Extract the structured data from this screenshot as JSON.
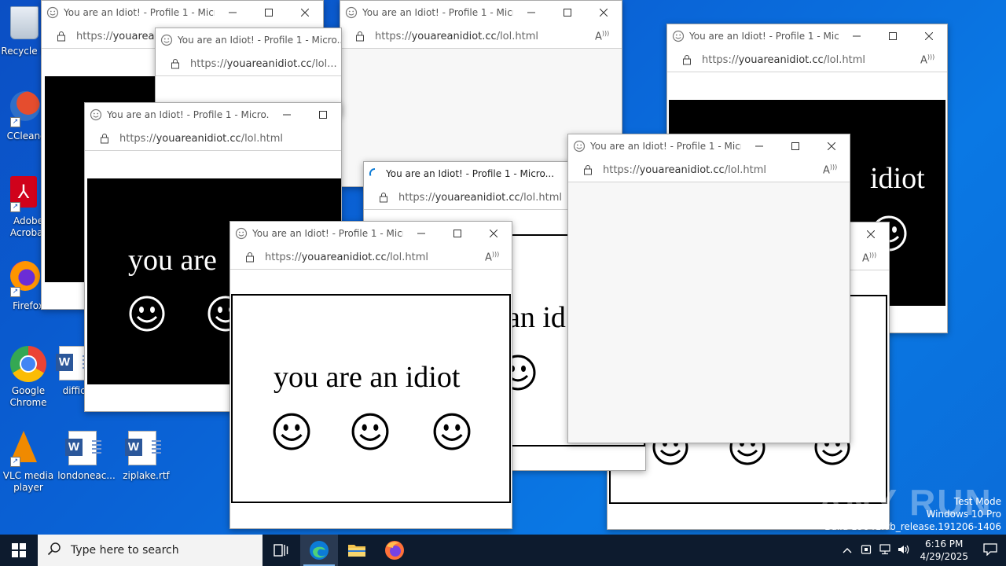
{
  "desktop": {
    "icons": [
      {
        "label": "Recycle Bin",
        "icon": "recycle-bin-icon"
      },
      {
        "label": "CCleaner",
        "icon": "ccleaner-icon"
      },
      {
        "label": "Adobe Acrobat",
        "icon": "acrobat-icon"
      },
      {
        "label": "Firefox",
        "icon": "firefox-icon"
      },
      {
        "label": "Google Chrome",
        "icon": "chrome-icon"
      },
      {
        "label": "VLC media player",
        "icon": "vlc-icon"
      },
      {
        "label": "difficu",
        "icon": "word-document-icon"
      },
      {
        "label": "londoneac...",
        "icon": "word-document-icon"
      },
      {
        "label": "ziplake.rtf",
        "icon": "word-document-icon"
      }
    ]
  },
  "browser": {
    "title": "You are an Idiot! - Profile 1 - Micro...",
    "url_prefix": "https://",
    "url_domain": "youareanidiot.cc",
    "url_path": "/lol.html",
    "url_truncated_path": "/lol...",
    "read_aloud_glyph": "Aͅ",
    "phrase": "you are an idiot",
    "phrase_start": "you are",
    "phrase_mid": "an id",
    "phrase_end": "idiot"
  },
  "taskbar": {
    "search_placeholder": "Type here to search",
    "time": "6:16 PM",
    "date": "4/29/2025"
  },
  "watermark": {
    "line1": "Test Mode",
    "line2": "Windows 10 Pro",
    "line3": "Build 19041.vb_release.191206-1406",
    "brand": "ANY RUN"
  },
  "colors": {
    "desktop_blue": "#0a63d6",
    "taskbar": "#0d1b2e",
    "edge_accent": "#0c7bd6"
  }
}
